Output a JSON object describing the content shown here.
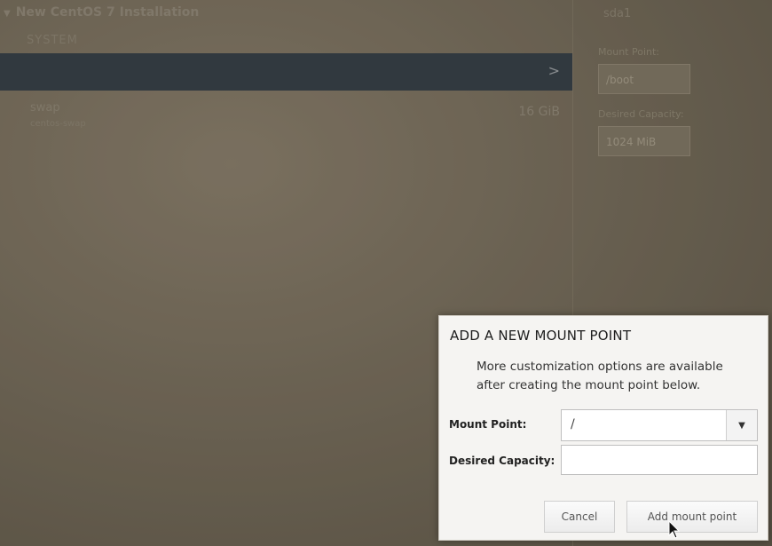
{
  "installer": {
    "header": "New CentOS 7 Installation",
    "section": "SYSTEM"
  },
  "partitions": [
    {
      "name": "swap",
      "subtitle": "centos-swap",
      "size": "16 GiB"
    }
  ],
  "details": {
    "device": "sda1",
    "mount_point_label": "Mount Point:",
    "mount_point_value": "/boot",
    "capacity_label": "Desired Capacity:",
    "capacity_value": "1024 MiB"
  },
  "dialog": {
    "title": "ADD A NEW MOUNT POINT",
    "description": "More customization options are available after creating the mount point below.",
    "mount_point_label": "Mount Point:",
    "mount_point_value": "/",
    "capacity_label": "Desired Capacity:",
    "capacity_value": "",
    "cancel_label": "Cancel",
    "add_label": "Add mount point"
  },
  "colors": {
    "selected_row": "#2f3a44",
    "dialog_bg": "#f5f4f2"
  }
}
